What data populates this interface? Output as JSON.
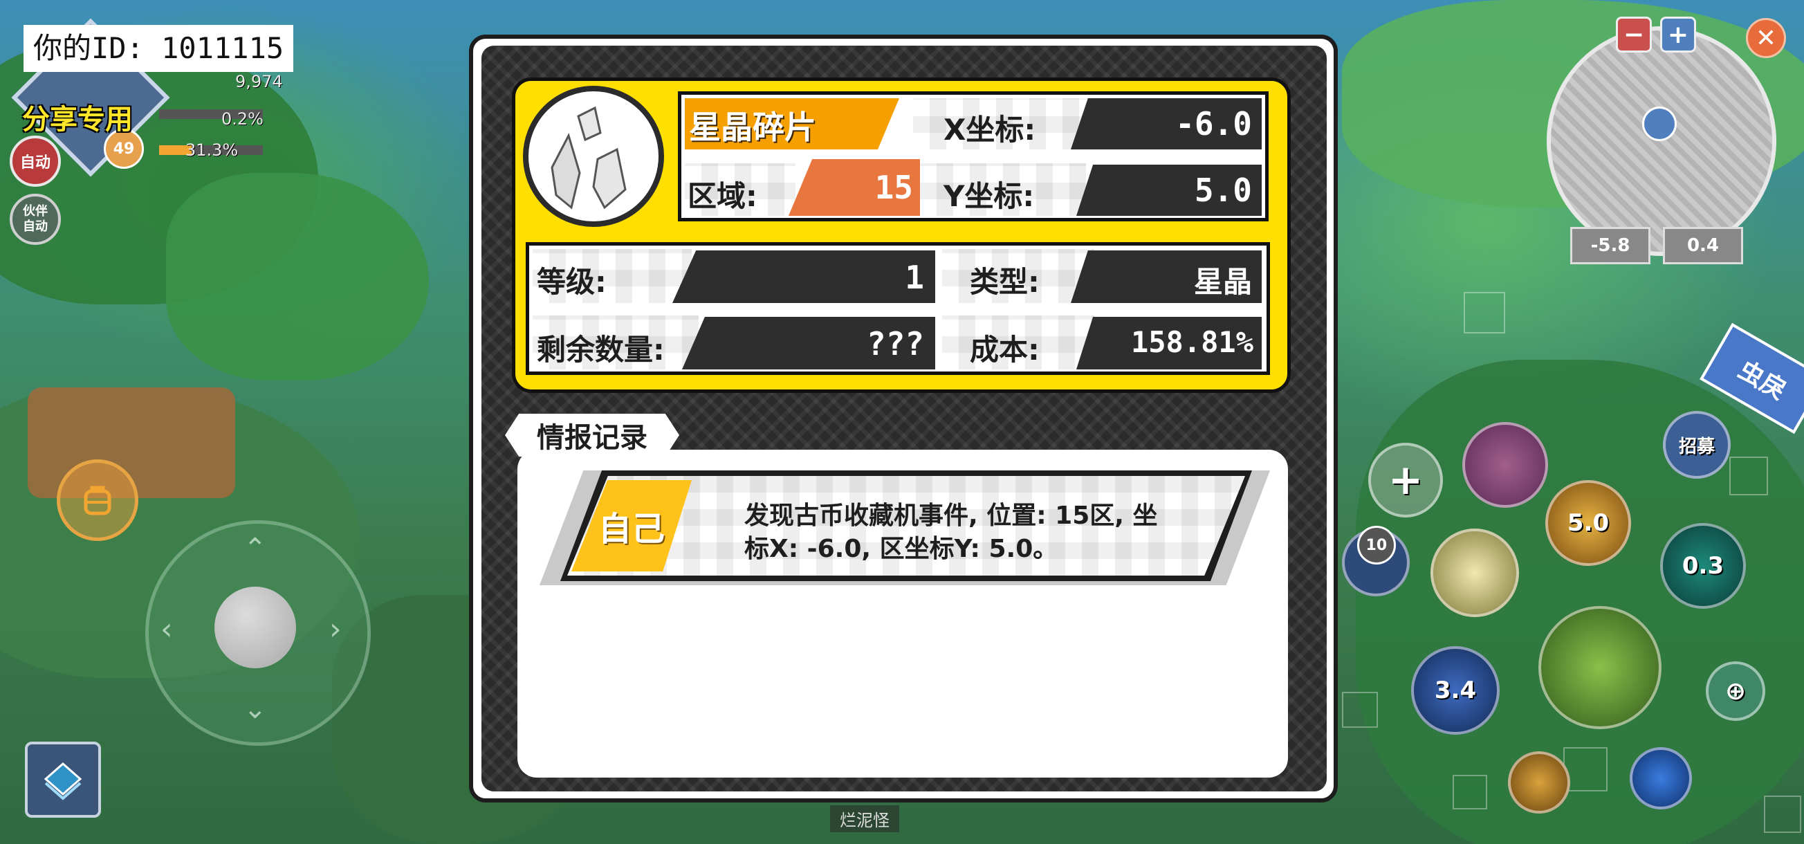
{
  "hud": {
    "id_label": "你的ID: 1011115",
    "share_text": "分享专用",
    "stat_top": "9,974",
    "stat_percent_1": "0.2%",
    "stat_percent_2": "31.3%",
    "level_badge": "49",
    "auto_label": "自动",
    "partner_auto_label": "伙伴\n自动",
    "bottom_name": "烂泥怪"
  },
  "minimap": {
    "coord_x": "-5.8",
    "coord_y": "0.4",
    "zoom_out": "−",
    "zoom_in": "+"
  },
  "skills": {
    "recruit": "招募",
    "s1": "5.0",
    "s2": "0.3",
    "s3": "3.4",
    "potion_count": "10",
    "flag_text": "虫戾"
  },
  "item": {
    "name": "星晶碎片",
    "x_label": "X坐标:",
    "x_value": "-6.0",
    "zone_label": "区域:",
    "zone_value": "15",
    "y_label": "Y坐标:",
    "y_value": "5.0",
    "level_label": "等级:",
    "level_value": "1",
    "type_label": "类型:",
    "type_value": "星晶",
    "remaining_label": "剩余数量:",
    "remaining_value": "???",
    "cost_label": "成本:",
    "cost_value": "158.81%"
  },
  "intel": {
    "tab_label": "情报记录",
    "entries": [
      {
        "tag": "自己",
        "text_line1": "发现古币收藏机事件, 位置: 15区, 坐",
        "text_line2": "标X: -6.0, 区坐标Y: 5.0。"
      }
    ]
  },
  "colors": {
    "panel_yellow": "#ffdf00",
    "name_orange": "#f5a000",
    "zone_orange": "#e8763f",
    "tag_yellow": "#ffc21a",
    "dark": "#2e2e2e"
  }
}
